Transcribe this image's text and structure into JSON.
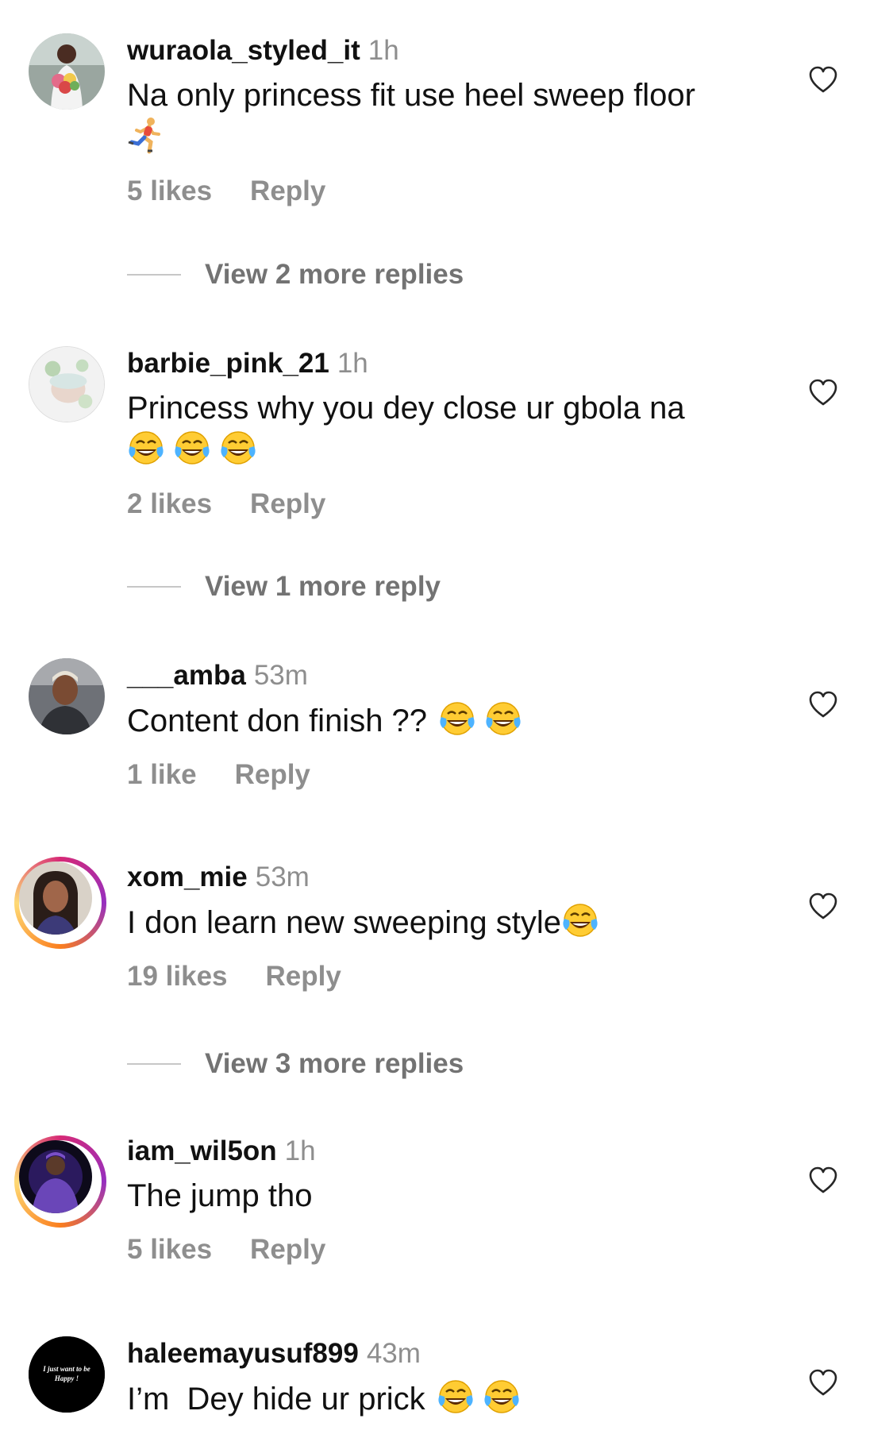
{
  "comments": [
    {
      "username": "wuraola_styled_it",
      "time": "1h",
      "text": "Na only princess fit use heel sweep floor",
      "emojis": [
        "running-person"
      ],
      "likes": "5 likes",
      "reply": "Reply",
      "view_replies": "View 2 more replies"
    },
    {
      "username": "barbie_pink_21",
      "time": "1h",
      "text": "Princess why you dey close ur gbola na",
      "emojis": [
        "tears-of-joy",
        "tears-of-joy",
        "tears-of-joy"
      ],
      "likes": "2 likes",
      "reply": "Reply",
      "view_replies": "View 1 more reply"
    },
    {
      "username": "___amba",
      "time": "53m",
      "text": "Content don finish ??",
      "emojis": [
        "tears-of-joy",
        "tears-of-joy"
      ],
      "likes": "1 like",
      "reply": "Reply"
    },
    {
      "username": "xom_mie",
      "time": "53m",
      "text": "I don learn new sweeping style",
      "emojis": [
        "tears-of-joy"
      ],
      "likes": "19 likes",
      "reply": "Reply",
      "view_replies": "View 3 more replies"
    },
    {
      "username": "iam_wil5on",
      "time": "1h",
      "text": "The jump tho",
      "likes": "5 likes",
      "reply": "Reply"
    },
    {
      "username": "haleemayusuf899",
      "time": "43m",
      "text": "I’m  Dey hide ur prick",
      "emojis": [
        "tears-of-joy",
        "tears-of-joy"
      ],
      "avatar_text": "I just want to be Happy !"
    }
  ],
  "icons": {
    "like": "heart-outline-icon",
    "story_ring_colors": [
      "#d62976",
      "#962fbf",
      "#fa7e1e",
      "#feda75"
    ]
  }
}
